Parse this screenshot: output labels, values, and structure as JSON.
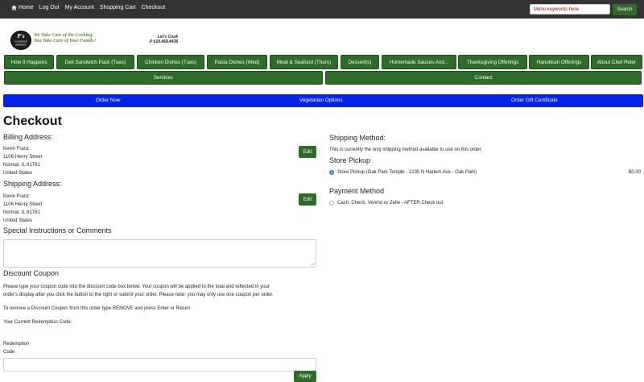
{
  "topnav": {
    "home": "Home",
    "logout": "Log Out",
    "account": "My Account",
    "cart": "Shopping Cart",
    "checkout": "Checkout"
  },
  "search": {
    "placeholder": "Menu keywords here",
    "button": "Search"
  },
  "logo": {
    "badge_top": "P's",
    "badge_bottom": "GOURMET MARKET",
    "tagline_1": "We Take Care of the Cooking,",
    "tagline_2": "You Take Care of Your Family!",
    "contact_1": "Let's Cook",
    "contact_2": "P 619.458.4436"
  },
  "nav": {
    "items": [
      "How It Happens",
      "Deli Sandwich Pack (Tues)",
      "Chicken Dishes (Tues)",
      "Pasta Dishes (Wed)",
      "Meat & Seafood (Thurs)",
      "Dessert(s)",
      "Homemade Sauces And...",
      "Thanksgiving Offerings",
      "Hanukkah Offerings",
      "About Chef Peter"
    ],
    "services": "Services",
    "contact": "Contact"
  },
  "bluebar": {
    "order_now": "Order Now",
    "vegetarian": "Vegetarian Options",
    "gift": "Order Gift Certificate"
  },
  "checkout": {
    "title": "Checkout",
    "billing_heading": "Billing Address:",
    "billing": [
      "Kevin Franz",
      "1106 Henry Street",
      "Normal, IL 61761",
      "United States"
    ],
    "shipping_heading": "Shipping Address:",
    "shipping": [
      "Kevin Franz",
      "1106 Henry Street",
      "Normal, IL 61761",
      "United States"
    ],
    "edit_label": "Edit",
    "special_heading": "Special Instructions or Comments",
    "coupon_heading": "Discount Coupon",
    "coupon_text_1": "Please type your coupon code into the discount code box below. Your coupon will be applied to the total and reflected in your",
    "coupon_text_2": "order's display after you click the button to the right or submit your order. Please note: you may only use one coupon per order.",
    "remove_text": "To remove a Discount Coupon from this order type REMOVE and press Enter or Return",
    "redemption_current": "Your Current Redemption Code:",
    "redemption_label_1": "Redemption",
    "redemption_label_2": "Code",
    "apply_label": "Apply"
  },
  "shipping_method": {
    "heading": "Shipping Method:",
    "note": "This is currently the only shipping method available to use on this order.",
    "store_heading": "Store Pickup",
    "option_label": "Store Pickup (Oak Park Temple - 1235 N Harlem Ave - Oak Park)",
    "option_price": "$0.00",
    "option_selected": true
  },
  "payment": {
    "heading": "Payment Method",
    "option_label": "Cash, Check, Venmo or Zelle - AFTER Check out",
    "option_selected": false
  },
  "colors": {
    "topbar": "#333333",
    "nav_green": "#2f6b2a",
    "blue_bar": "#0723e8",
    "radio_blue": "#2c7be5"
  }
}
